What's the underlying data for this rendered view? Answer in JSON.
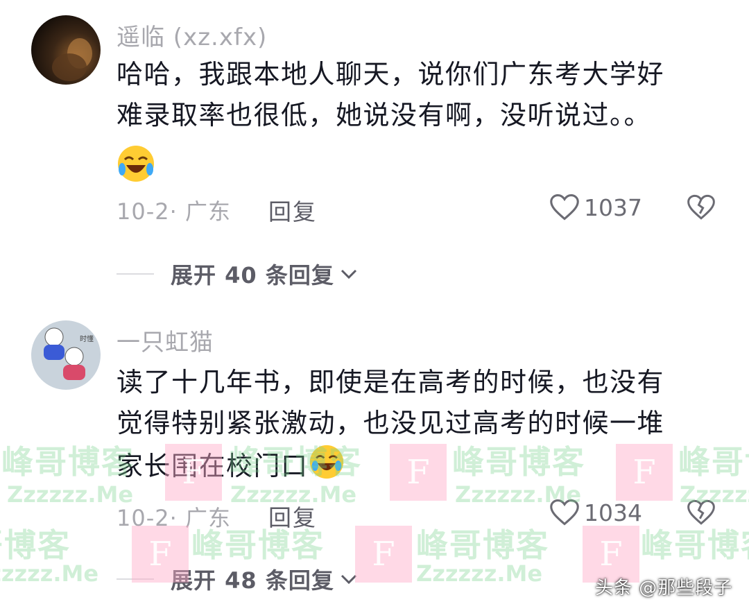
{
  "comments": [
    {
      "username": "遥临 (xz.xfx)",
      "text": "哈哈，我跟本地人聊天，说你们广东考大学好\n难录取率也很低，她说没有啊，没听说过。。",
      "emoji": "laugh-cry-emoji",
      "meta": "10-2· 广东",
      "reply_label": "回复",
      "likes": "1037",
      "expand_label": "展开 40 条回复"
    },
    {
      "username": "一只虹猫",
      "text": "读了十几年书，即使是在高考的时候，也没有\n觉得特别紧张激动，也没见过高考的时候一堆\n家长围在校门口",
      "emoji": "tearful-laugh-emoji",
      "avatar_caption": "时懂",
      "meta": "10-2· 广东",
      "reply_label": "回复",
      "likes": "1034",
      "expand_label": "展开 48 条回复"
    }
  ],
  "watermark": {
    "brand": "峰哥博客",
    "domain": "Zzzzzz.Me",
    "box_letter": "F"
  },
  "credit": "头条 @那些段子",
  "colors": {
    "text": "#161823",
    "muted": "#a8a8ae",
    "watermark_green": "#78d28c",
    "watermark_pink": "#ffaac8"
  }
}
